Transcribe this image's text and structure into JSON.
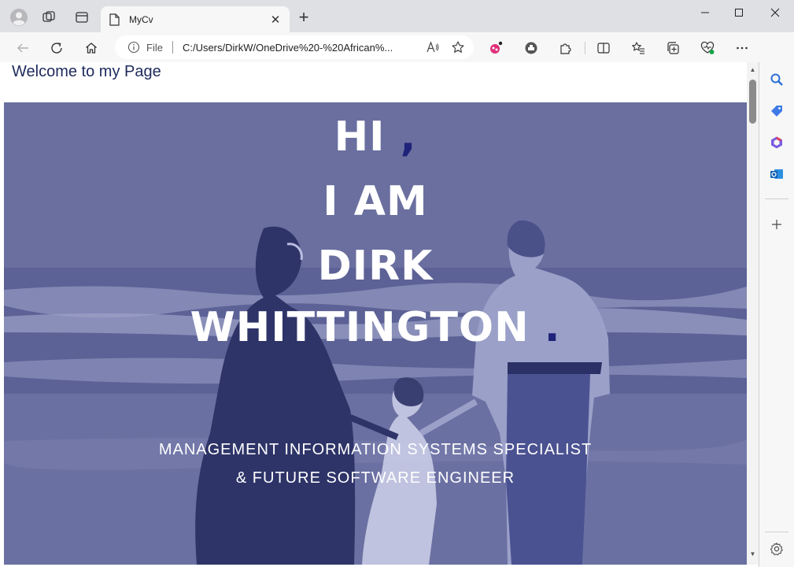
{
  "tab": {
    "title": "MyCv"
  },
  "address_bar": {
    "protocol": "File",
    "url": "C:/Users/DirkW/OneDrive%20-%20African%..."
  },
  "page": {
    "welcome": "Welcome to my Page",
    "hero": {
      "line1": "HI",
      "line1_accent": ",",
      "line2": "I AM",
      "line3": "DIRK",
      "line4": "WHITTINGTON",
      "line4_accent": ".",
      "subtitle1": "MANAGEMENT INFORMATION SYSTEMS SPECIALIST",
      "subtitle2": "& FUTURE SOFTWARE ENGINEER"
    }
  },
  "colors": {
    "hero_overlay": "#6a6f9f",
    "accent": "#1f237a",
    "welcome_text": "#1e2a5c"
  }
}
